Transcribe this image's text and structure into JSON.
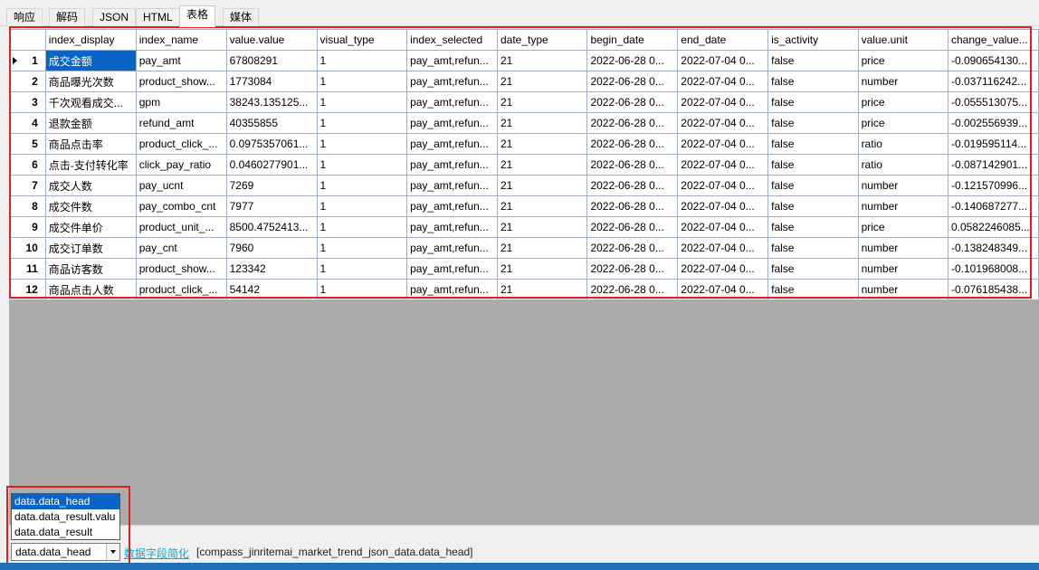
{
  "tabs": [
    {
      "label": "响应",
      "active": false
    },
    {
      "label": "解码",
      "active": false
    },
    {
      "label": "JSON",
      "active": false
    },
    {
      "label": "HTML",
      "active": false
    },
    {
      "label": "表格",
      "active": true
    },
    {
      "label": "媒体",
      "active": false
    }
  ],
  "table": {
    "columns": [
      "index_display",
      "index_name",
      "value.value",
      "visual_type",
      "index_selected",
      "date_type",
      "begin_date",
      "end_date",
      "is_activity",
      "value.unit",
      "change_value..."
    ],
    "rows": [
      {
        "num": "1",
        "cells": [
          "成交金额",
          "pay_amt",
          "67808291",
          "1",
          "pay_amt,refun...",
          "21",
          "2022-06-28 0...",
          "2022-07-04 0...",
          "false",
          "price",
          "-0.090654130..."
        ]
      },
      {
        "num": "2",
        "cells": [
          "商品曝光次数",
          "product_show...",
          "1773084",
          "1",
          "pay_amt,refun...",
          "21",
          "2022-06-28 0...",
          "2022-07-04 0...",
          "false",
          "number",
          "-0.037116242..."
        ]
      },
      {
        "num": "3",
        "cells": [
          "千次观看成交...",
          "gpm",
          "38243.135125...",
          "1",
          "pay_amt,refun...",
          "21",
          "2022-06-28 0...",
          "2022-07-04 0...",
          "false",
          "price",
          "-0.055513075..."
        ]
      },
      {
        "num": "4",
        "cells": [
          "退款金额",
          "refund_amt",
          "40355855",
          "1",
          "pay_amt,refun...",
          "21",
          "2022-06-28 0...",
          "2022-07-04 0...",
          "false",
          "price",
          "-0.002556939..."
        ]
      },
      {
        "num": "5",
        "cells": [
          "商品点击率",
          "product_click_...",
          "0.0975357061...",
          "1",
          "pay_amt,refun...",
          "21",
          "2022-06-28 0...",
          "2022-07-04 0...",
          "false",
          "ratio",
          "-0.019595114..."
        ]
      },
      {
        "num": "6",
        "cells": [
          "点击-支付转化率",
          "click_pay_ratio",
          "0.0460277901...",
          "1",
          "pay_amt,refun...",
          "21",
          "2022-06-28 0...",
          "2022-07-04 0...",
          "false",
          "ratio",
          "-0.087142901..."
        ]
      },
      {
        "num": "7",
        "cells": [
          "成交人数",
          "pay_ucnt",
          "7269",
          "1",
          "pay_amt,refun...",
          "21",
          "2022-06-28 0...",
          "2022-07-04 0...",
          "false",
          "number",
          "-0.121570996..."
        ]
      },
      {
        "num": "8",
        "cells": [
          "成交件数",
          "pay_combo_cnt",
          "7977",
          "1",
          "pay_amt,refun...",
          "21",
          "2022-06-28 0...",
          "2022-07-04 0...",
          "false",
          "number",
          "-0.140687277..."
        ]
      },
      {
        "num": "9",
        "cells": [
          "成交件单价",
          "product_unit_...",
          "8500.4752413...",
          "1",
          "pay_amt,refun...",
          "21",
          "2022-06-28 0...",
          "2022-07-04 0...",
          "false",
          "price",
          "0.0582246085..."
        ]
      },
      {
        "num": "10",
        "cells": [
          "成交订单数",
          "pay_cnt",
          "7960",
          "1",
          "pay_amt,refun...",
          "21",
          "2022-06-28 0...",
          "2022-07-04 0...",
          "false",
          "number",
          "-0.138248349..."
        ]
      },
      {
        "num": "11",
        "cells": [
          "商品访客数",
          "product_show...",
          "123342",
          "1",
          "pay_amt,refun...",
          "21",
          "2022-06-28 0...",
          "2022-07-04 0...",
          "false",
          "number",
          "-0.101968008..."
        ]
      },
      {
        "num": "12",
        "cells": [
          "商品点击人数",
          "product_click_...",
          "54142",
          "1",
          "pay_amt,refun...",
          "21",
          "2022-06-28 0...",
          "2022-07-04 0...",
          "false",
          "number",
          "-0.076185438..."
        ]
      }
    ]
  },
  "dropdown": {
    "options": [
      "data.data_head",
      "data.data_result.valu",
      "data.data_result"
    ],
    "selected": "data.data_head"
  },
  "status": {
    "combo_value": "data.data_head",
    "link_label": "数据字段简化",
    "path_text": "[compass_jinritemai_market_trend_json_data.data_head]"
  },
  "colors": {
    "selection": "#0a64c8",
    "highlight_box": "#e02020",
    "link": "#1aa6c8"
  }
}
